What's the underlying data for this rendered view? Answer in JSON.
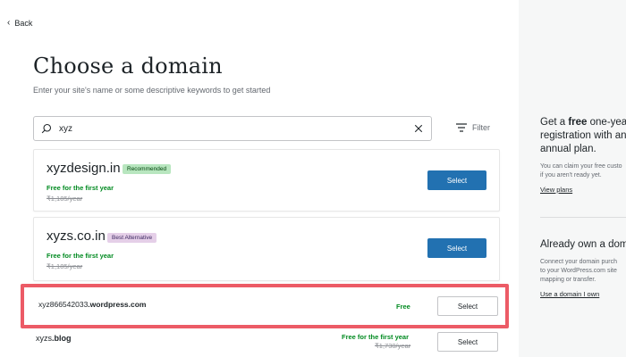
{
  "nav": {
    "back_label": "Back"
  },
  "header": {
    "title": "Choose a domain",
    "subtitle": "Enter your site's name or some descriptive keywords to get started"
  },
  "search": {
    "value": "xyz",
    "filter_label": "Filter"
  },
  "results": [
    {
      "domain": "xyzdesign.in",
      "badge": "Recommended",
      "free_text": "Free for the first year",
      "old_price": "₹1,185/year",
      "select_label": "Select"
    },
    {
      "domain": "xyzs.co.in",
      "badge": "Best Alternative",
      "free_text": "Free for the first year",
      "old_price": "₹1,185/year",
      "select_label": "Select"
    },
    {
      "domain_prefix": "xyz866542033",
      "domain_suffix": ".wordpress.com",
      "free_text": "Free",
      "select_label": "Select"
    },
    {
      "domain_prefix": "xyzs",
      "domain_suffix": ".blog",
      "free_text": "Free for the first year",
      "old_price": "₹1,730/year",
      "select_label": "Select"
    }
  ],
  "sidebar": {
    "promo": {
      "title_pre": "Get a ",
      "title_bold": "free",
      "title_l1_post": " one-year",
      "title_l2": "registration with an",
      "title_l3": "annual plan.",
      "desc_l1": "You can claim your free custo",
      "desc_l2": "if you aren't ready yet.",
      "link": "View plans"
    },
    "own": {
      "title": "Already own a dom",
      "desc_l1": "Connect your domain purch",
      "desc_l2": "to your WordPress.com site",
      "desc_l3": "mapping or transfer.",
      "link": "Use a domain I own"
    }
  },
  "colors": {
    "primary": "#2271b1",
    "success": "#008a20",
    "highlight": "#ec5b66",
    "badge_recommended": "#b8e6bf",
    "badge_best": "#e5cfe8"
  }
}
